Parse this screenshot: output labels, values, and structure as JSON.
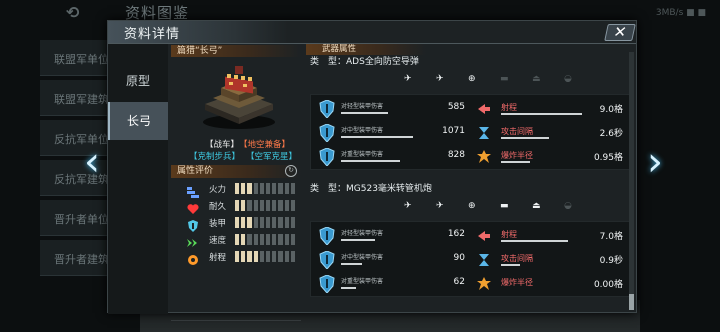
{
  "background": {
    "title": "资料图鉴",
    "status": "3MB/s ■ ■",
    "left_items": [
      "联盟军单位",
      "联盟军建筑",
      "反抗军单位",
      "反抗军建筑",
      "晋升者单位",
      "晋升者建筑"
    ]
  },
  "dialog": {
    "title": "资料详情",
    "close_label": "✕",
    "tabs": [
      {
        "label": "原型",
        "active": false
      },
      {
        "label": "长弓",
        "active": true
      }
    ]
  },
  "unit": {
    "header": "篇猎“长弓”",
    "tags": [
      {
        "text": "【战车】",
        "color": "#e8e8e8"
      },
      {
        "text": "【地空兼备】",
        "color": "#ff7a4a"
      },
      {
        "text": "【克制步兵】",
        "color": "#3ec8e0"
      },
      {
        "text": "【空军克星】",
        "color": "#3ec8e0"
      }
    ],
    "attr_header": "属性评价",
    "attributes": [
      {
        "label": "火力",
        "level": 3,
        "max": 10,
        "icon": "firepower-icon",
        "color": "#6aa0ff"
      },
      {
        "label": "耐久",
        "level": 2,
        "max": 10,
        "icon": "heart-icon",
        "color": "#ff3a3a"
      },
      {
        "label": "装甲",
        "level": 3,
        "max": 10,
        "icon": "armor-icon",
        "color": "#52c8e8"
      },
      {
        "label": "速度",
        "level": 2,
        "max": 10,
        "icon": "speed-icon",
        "color": "#5adc5a"
      },
      {
        "label": "射程",
        "level": 4,
        "max": 10,
        "icon": "range-icon",
        "color": "#ff9a2a"
      }
    ]
  },
  "weapons": {
    "header": "武器属性",
    "list": [
      {
        "type_label": "类　型：",
        "name": "ADS全向防空导弹",
        "targets": [
          {
            "icon": "plane-icon",
            "active": true
          },
          {
            "icon": "jet-icon",
            "active": true
          },
          {
            "icon": "helicopter-icon",
            "active": true
          },
          {
            "icon": "tank-icon",
            "active": false
          },
          {
            "icon": "ship-icon",
            "active": false
          },
          {
            "icon": "submarine-icon",
            "active": false
          }
        ],
        "damage": [
          {
            "label": "对轻型装甲伤害",
            "value": "585",
            "fill": 0.55
          },
          {
            "label": "对中型装甲伤害",
            "value": "1071",
            "fill": 0.85
          },
          {
            "label": "对重型装甲伤害",
            "value": "828",
            "fill": 0.7
          }
        ],
        "stats": [
          {
            "label": "射程",
            "value": "9.0格",
            "fill": 0.85,
            "icon": "range-stat-icon"
          },
          {
            "label": "攻击间隔",
            "value": "2.6秒",
            "fill": 0.5,
            "icon": "hourglass-icon"
          },
          {
            "label": "爆炸半径",
            "value": "0.95格",
            "fill": 0.3,
            "icon": "explosion-icon"
          }
        ]
      },
      {
        "type_label": "类　型：",
        "name": "MG523毫米转管机炮",
        "targets": [
          {
            "icon": "plane-icon",
            "active": true
          },
          {
            "icon": "jet-icon",
            "active": true
          },
          {
            "icon": "helicopter-icon",
            "active": true
          },
          {
            "icon": "tank-icon",
            "active": true
          },
          {
            "icon": "ship-icon",
            "active": true
          },
          {
            "icon": "submarine-icon",
            "active": false
          }
        ],
        "damage": [
          {
            "label": "对轻型装甲伤害",
            "value": "162",
            "fill": 0.4
          },
          {
            "label": "对中型装甲伤害",
            "value": "90",
            "fill": 0.25
          },
          {
            "label": "对重型装甲伤害",
            "value": "62",
            "fill": 0.18
          }
        ],
        "stats": [
          {
            "label": "射程",
            "value": "7.0格",
            "fill": 0.7,
            "icon": "range-stat-icon"
          },
          {
            "label": "攻击间隔",
            "value": "0.9秒",
            "fill": 0.2,
            "icon": "hourglass-icon"
          },
          {
            "label": "爆炸半径",
            "value": "0.00格",
            "fill": 0.0,
            "icon": "explosion-icon"
          }
        ]
      }
    ]
  }
}
